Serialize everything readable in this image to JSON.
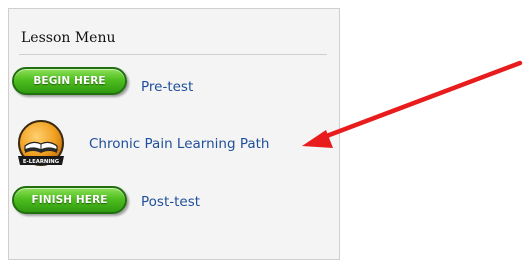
{
  "lesson_menu": {
    "title": "Lesson Menu",
    "items": [
      {
        "button_label": "BEGIN HERE",
        "link_text": "Pre-test"
      },
      {
        "icon_label": "E-LEARNING",
        "link_text": "Chronic Pain Learning Path"
      },
      {
        "button_label": "FINISH HERE",
        "link_text": "Post-test"
      }
    ]
  },
  "colors": {
    "button_green": "#4fbf1f",
    "link_blue": "#1f4f9a",
    "annotation_arrow": "#e81c1c",
    "icon_orange": "#f0a020"
  },
  "icons": {
    "elearning": "book-elearning-icon",
    "annotation": "red-arrow-annotation"
  }
}
